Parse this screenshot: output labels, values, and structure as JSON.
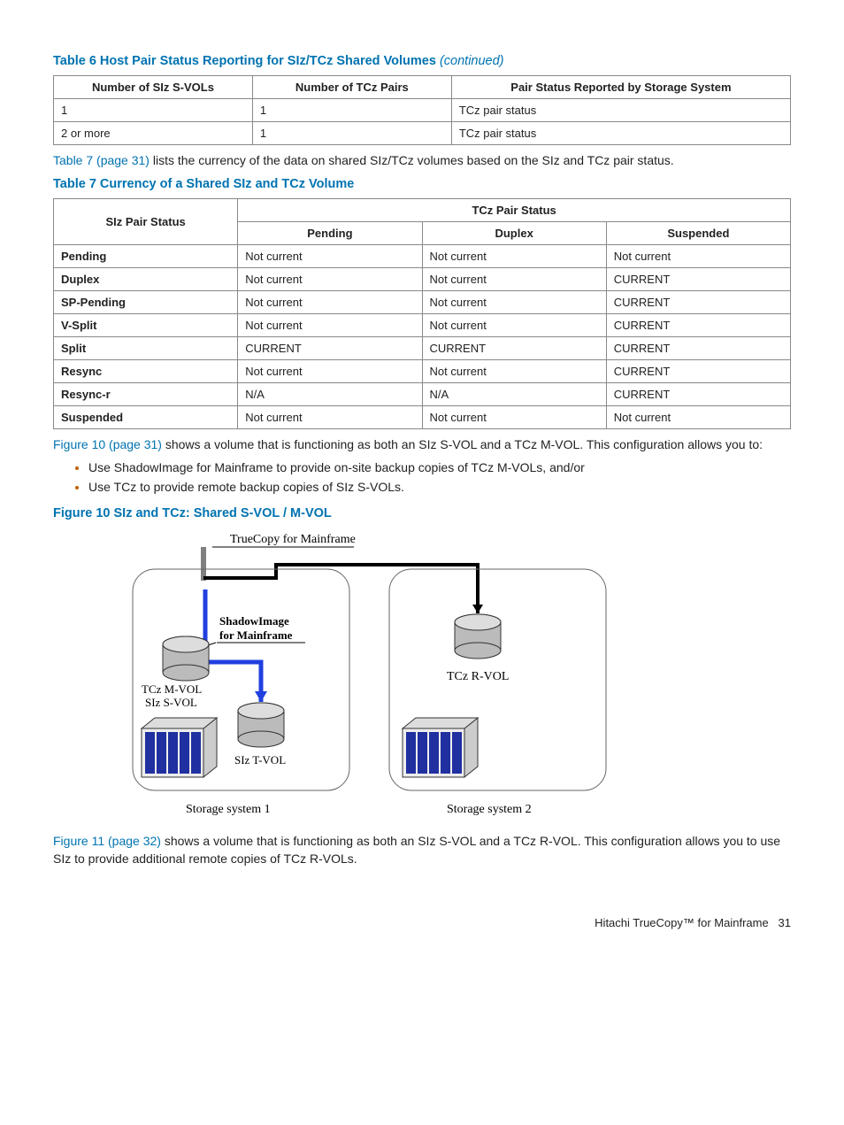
{
  "table6": {
    "title_prefix": "Table 6 Host Pair Status Reporting for SIz/TCz Shared Volumes ",
    "title_suffix": "(continued)",
    "headers": [
      "Number of SIz S-VOLs",
      "Number of TCz Pairs",
      "Pair Status Reported by Storage System"
    ],
    "rows": [
      [
        "1",
        "1",
        "TCz pair status"
      ],
      [
        "2 or more",
        "1",
        "TCz pair status"
      ]
    ]
  },
  "para1": {
    "link": "Table 7 (page 31)",
    "rest": " lists the currency of the data on shared SIz/TCz volumes based on the SIz and TCz pair status."
  },
  "table7": {
    "title": "Table 7 Currency of a Shared SIz and TCz Volume",
    "row_header": "SIz Pair Status",
    "group_header": "TCz Pair Status",
    "subheaders": [
      "Pending",
      "Duplex",
      "Suspended"
    ],
    "rows": [
      [
        "Pending",
        "Not current",
        "Not current",
        "Not current"
      ],
      [
        "Duplex",
        "Not current",
        "Not current",
        "CURRENT"
      ],
      [
        "SP-Pending",
        "Not current",
        "Not current",
        "CURRENT"
      ],
      [
        "V-Split",
        "Not current",
        "Not current",
        "CURRENT"
      ],
      [
        "Split",
        "CURRENT",
        "CURRENT",
        "CURRENT"
      ],
      [
        "Resync",
        "Not current",
        "Not current",
        "CURRENT"
      ],
      [
        "Resync-r",
        "N/A",
        "N/A",
        "CURRENT"
      ],
      [
        "Suspended",
        "Not current",
        "Not current",
        "Not current"
      ]
    ]
  },
  "para2": {
    "link": "Figure 10 (page 31)",
    "rest": " shows a volume that is functioning as both an SIz S-VOL and a TCz M-VOL. This configuration allows you to:"
  },
  "bullets": [
    "Use ShadowImage for Mainframe to provide on-site backup copies of TCz M-VOLs, and/or",
    "Use TCz to provide remote backup copies of SIz S-VOLs."
  ],
  "figure10": {
    "title": "Figure 10 SIz and TCz: Shared S-VOL / M-VOL",
    "labels": {
      "top": "TrueCopy for Mainframe",
      "shadow": "ShadowImage\nfor Mainframe",
      "mvol": "TCz M-VOL\nSIz S-VOL",
      "tvol": "SIz T-VOL",
      "rvol": "TCz R-VOL",
      "sys1": "Storage system 1",
      "sys2": "Storage system 2"
    }
  },
  "para3": {
    "link": "Figure 11 (page 32)",
    "rest": " shows a volume that is functioning as both an SIz S-VOL and a TCz R-VOL. This configuration allows you to use SIz to provide additional remote copies of TCz R-VOLs."
  },
  "footer": {
    "text": "Hitachi TrueCopy™ for Mainframe",
    "page": "31"
  }
}
